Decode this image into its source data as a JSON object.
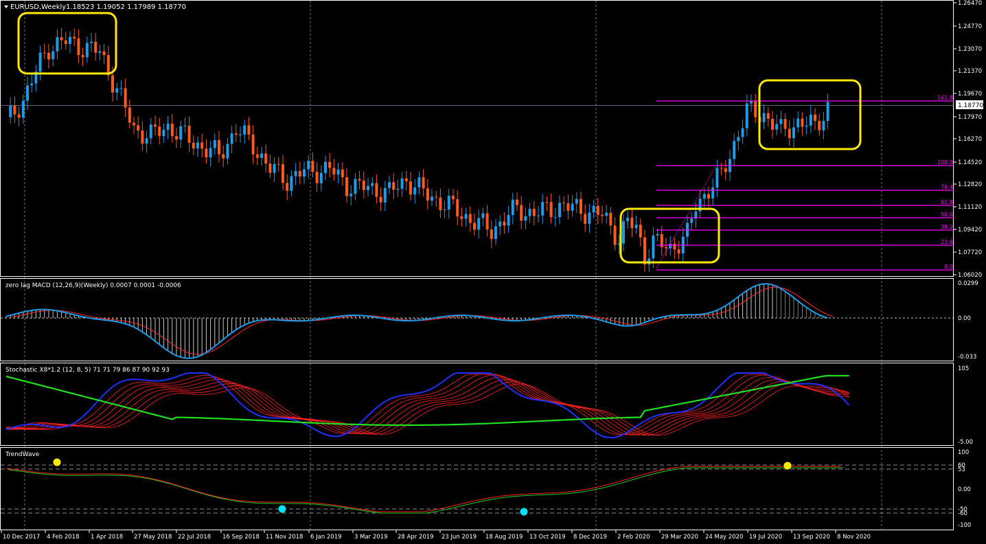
{
  "colors": {
    "background": "#000000",
    "bull": "#1e9be6",
    "bear": "#ff5a1e",
    "fib": "#ff00ff",
    "highlight": "#ffea00",
    "macd_line": "#1e9be6",
    "macd_signal": "#ff2a2a",
    "stoch_main": "#2030ff",
    "stoch_red": "#ff2020",
    "stoch_green": "#20e020",
    "tw_red": "#ff2020",
    "tw_green": "#20d020",
    "dot_yellow": "#ffea00",
    "dot_cyan": "#00e0ff",
    "text": "#ffffff",
    "grid": "#ffffff"
  },
  "main": {
    "header_title": "EURUSD,Weekly",
    "header_ohlc": "1.18523 1.19052 1.17989 1.18770",
    "current_price": "1.18770",
    "price_scale": [
      "1.26470",
      "1.24770",
      "1.23070",
      "1.21370",
      "1.19670",
      "1.17970",
      "1.16270",
      "1.14520",
      "1.12820",
      "1.11120",
      "1.09420",
      "1.07720",
      "1.06020"
    ],
    "fib_levels": [
      "161.8",
      "100.0",
      "76.4",
      "61.8",
      "50.0",
      "38.2",
      "23.6",
      "0.0"
    ],
    "icons": [
      "triangle-down-icon"
    ]
  },
  "macd": {
    "title": "zero lag MACD (12,26,9)(Weekly) 0.0007 0.0001 -0.0006",
    "scale": [
      "0.0299",
      "0.00",
      "-0.033"
    ]
  },
  "stochastic": {
    "title": "Stochastic X8*1.2 (12, 8, 5) 71 71 79 86 87 90 92 93",
    "scale": [
      "105",
      "-5.00"
    ]
  },
  "trendwave": {
    "title": "TrendWave",
    "scale": [
      "100",
      "60",
      "53",
      "0.00",
      "-50",
      "-60",
      "-100"
    ]
  },
  "time_axis": [
    "10 Dec 2017",
    "4 Feb 2018",
    "1 Apr 2018",
    "27 May 2018",
    "22 Jul 2018",
    "16 Sep 2018",
    "11 Nov 2018",
    "6 Jan 2019",
    "3 Mar 2019",
    "28 Apr 2019",
    "23 Jun 2019",
    "18 Aug 2019",
    "13 Oct 2019",
    "8 Dec 2019",
    "2 Feb 2020",
    "29 Mar 2020",
    "24 May 2020",
    "19 Jul 2020",
    "13 Sep 2020",
    "8 Nov 2020"
  ]
}
